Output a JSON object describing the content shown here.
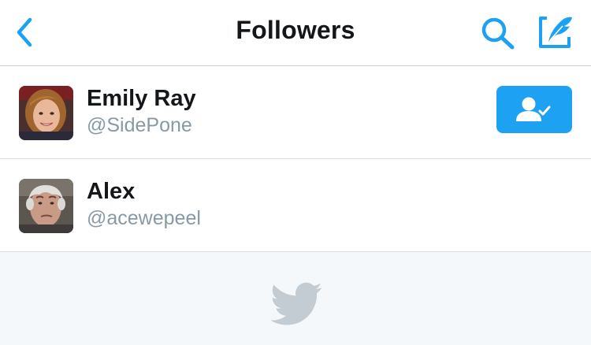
{
  "header": {
    "title": "Followers",
    "back_icon": "chevron-left-icon",
    "search_icon": "search-icon",
    "compose_icon": "compose-tweet-icon",
    "accent_color": "#1da1f2"
  },
  "followers": [
    {
      "name": "Emily Ray",
      "handle": "@SidePone",
      "avatar": "profile-photo",
      "following": true,
      "button_icon": "following-check-icon"
    },
    {
      "name": "Alex",
      "handle": "@acewepeel",
      "avatar": "profile-photo",
      "following": false
    }
  ],
  "footer": {
    "icon": "twitter-bird-icon"
  }
}
